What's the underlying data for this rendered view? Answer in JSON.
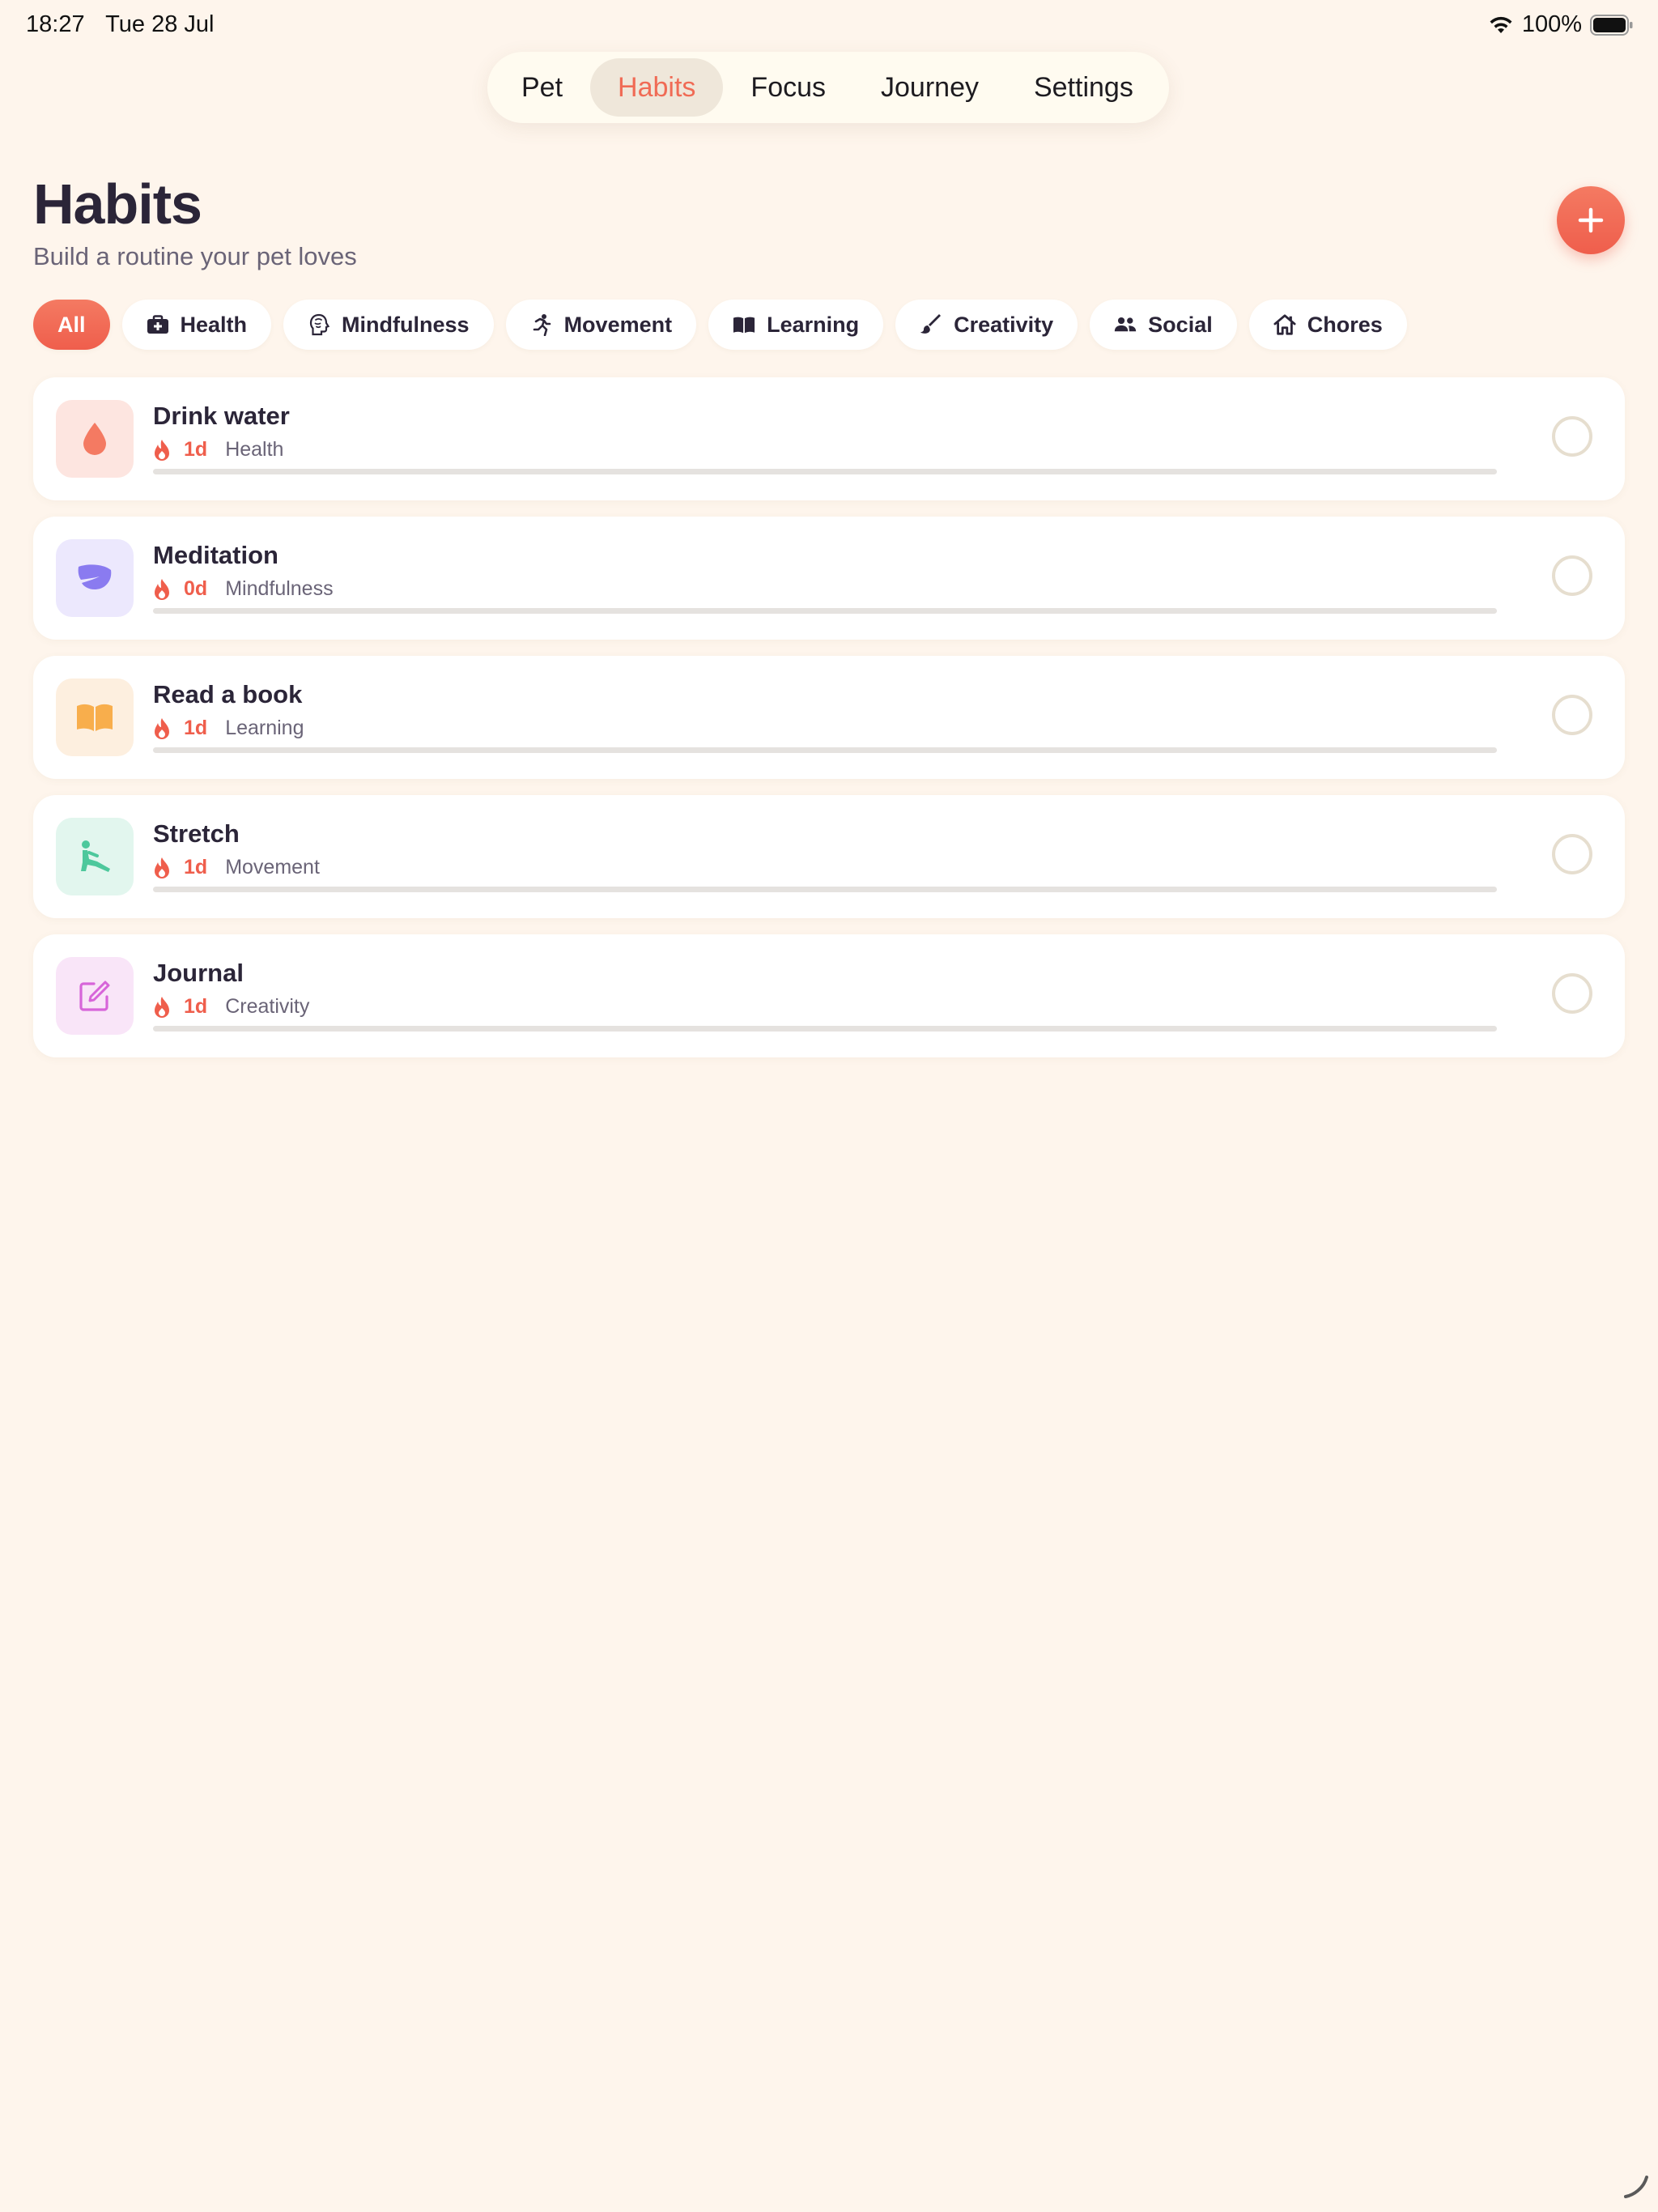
{
  "status_bar": {
    "time": "18:27",
    "date": "Tue 28 Jul",
    "battery": "100%"
  },
  "tabs": [
    {
      "label": "Pet",
      "active": false
    },
    {
      "label": "Habits",
      "active": true
    },
    {
      "label": "Focus",
      "active": false
    },
    {
      "label": "Journey",
      "active": false
    },
    {
      "label": "Settings",
      "active": false
    }
  ],
  "header": {
    "title": "Habits",
    "subtitle": "Build a routine your pet loves"
  },
  "filters": [
    {
      "label": "All",
      "icon": "",
      "active": true
    },
    {
      "label": "Health",
      "icon": "medkit-icon",
      "active": false
    },
    {
      "label": "Mindfulness",
      "icon": "brain-head-icon",
      "active": false
    },
    {
      "label": "Movement",
      "icon": "running-person-icon",
      "active": false
    },
    {
      "label": "Learning",
      "icon": "open-book-icon",
      "active": false
    },
    {
      "label": "Creativity",
      "icon": "paintbrush-icon",
      "active": false
    },
    {
      "label": "Social",
      "icon": "people-icon",
      "active": false
    },
    {
      "label": "Chores",
      "icon": "house-icon",
      "active": false
    }
  ],
  "habits": [
    {
      "name": "Drink water",
      "streak": "1d",
      "category": "Health",
      "icon": "water-drop-icon",
      "icon_color": "#F47A62",
      "icon_bg": "#FDE5E0",
      "progress": 0
    },
    {
      "name": "Meditation",
      "streak": "0d",
      "category": "Mindfulness",
      "icon": "leaf-icon",
      "icon_color": "#8A7BF0",
      "icon_bg": "#ECE8FD",
      "progress": 0
    },
    {
      "name": "Read a book",
      "streak": "1d",
      "category": "Learning",
      "icon": "open-book-icon",
      "icon_color": "#F8AE4C",
      "icon_bg": "#FDEFDF",
      "progress": 0
    },
    {
      "name": "Stretch",
      "streak": "1d",
      "category": "Movement",
      "icon": "stretching-person-icon",
      "icon_color": "#4DC89C",
      "icon_bg": "#E2F6EE",
      "progress": 0
    },
    {
      "name": "Journal",
      "streak": "1d",
      "category": "Creativity",
      "icon": "edit-square-icon",
      "icon_color": "#D765D9",
      "icon_bg": "#F9E5F8",
      "progress": 0
    }
  ],
  "colors": {
    "accent": "#EF5E4C",
    "background": "#FEF5EC"
  }
}
